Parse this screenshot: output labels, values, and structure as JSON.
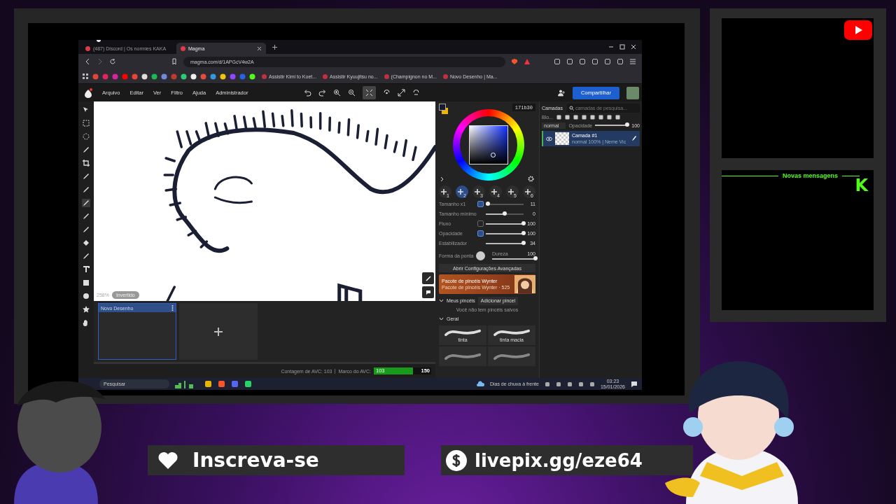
{
  "browser": {
    "tabs": [
      {
        "title": "(487) Discord | Os normies KAKA",
        "selected": false
      },
      {
        "title": "Magma",
        "selected": true
      }
    ],
    "url": "magma.com/d/1APGcV4w2A",
    "bookmarks": [
      "Assistir Kimi to Koet...",
      "Assistir Kyuujitsu no...",
      "(Champignon no M...",
      "Novo Desenho | Ma..."
    ]
  },
  "app": {
    "menu": [
      "Arquivo",
      "Editar",
      "Ver",
      "Filtro",
      "Ajuda",
      "Administrador"
    ],
    "share_button": "Compartilhar"
  },
  "canvas": {
    "zoom": "258%",
    "filter_chip": "Invertido"
  },
  "documents": [
    {
      "title": "Novo Desenho",
      "selected": true
    }
  ],
  "stroke_counter": {
    "label": "Contagem de AVC: 103",
    "milestone_label": "Marco do AVC:",
    "value": "103",
    "max": "150",
    "level": 0.687
  },
  "color": {
    "hex": "171b30"
  },
  "brush_slots": [
    {
      "number": "1",
      "selected": false
    },
    {
      "number": "2",
      "selected": true
    },
    {
      "number": "3",
      "selected": false
    },
    {
      "number": "4",
      "selected": false
    },
    {
      "number": "5",
      "selected": false
    },
    {
      "number": "6",
      "selected": false
    }
  ],
  "sliders": [
    {
      "label": "Tamanho x1",
      "value": "11",
      "level": 0.05,
      "pressure_toggle": true
    },
    {
      "label": "Tamanho mínimo",
      "value": "0",
      "level": 0.5
    },
    {
      "label": "Fluxo",
      "value": "100",
      "level": 1,
      "pressure_toggle": false
    },
    {
      "label": "Opacidade",
      "value": "100",
      "level": 1,
      "pressure_toggle": true
    },
    {
      "label": "Estabilizador",
      "value": "34",
      "level": 1
    }
  ],
  "tip": {
    "label": "Forma da ponta",
    "hardness_label": "Dureza",
    "hardness_value": "100",
    "level": 1
  },
  "advanced_button": "Abrir Configurações Avançadas",
  "promo": {
    "title": "Pacote de pincéis Wynter",
    "subtitle": "Pacote de pincéis Wynter · 525"
  },
  "my_brushes": {
    "title": "Meus pincéis",
    "expanded": true,
    "add_button": "Adicionar pincel",
    "empty": "Você não tem pincéis salvos"
  },
  "general": {
    "title": "Geral",
    "expanded": true,
    "brushes": [
      "tinta",
      "tinta macia"
    ]
  },
  "layers": {
    "title": "Camadas",
    "search_placeholder": "camadas de pesquisa...",
    "blend_label": "Blo...",
    "blend_mode": "normal",
    "opacity": {
      "label": "Opacidade",
      "value": "100",
      "level": 1
    },
    "items": [
      {
        "name": "Camada #1",
        "info": "normal 100% | Neme Vic",
        "selected": true,
        "visible": true
      }
    ]
  },
  "taskbar": {
    "search_placeholder": "Pesquisar",
    "weather": "Dias de chuva à frente",
    "time": "03:23",
    "date": "15/01/2026"
  },
  "overlay": {
    "chat_title": "Novas mensagens",
    "kick_logo": "K",
    "subscribe": "Inscreva-se",
    "donation": "livepix.gg/eze64"
  }
}
